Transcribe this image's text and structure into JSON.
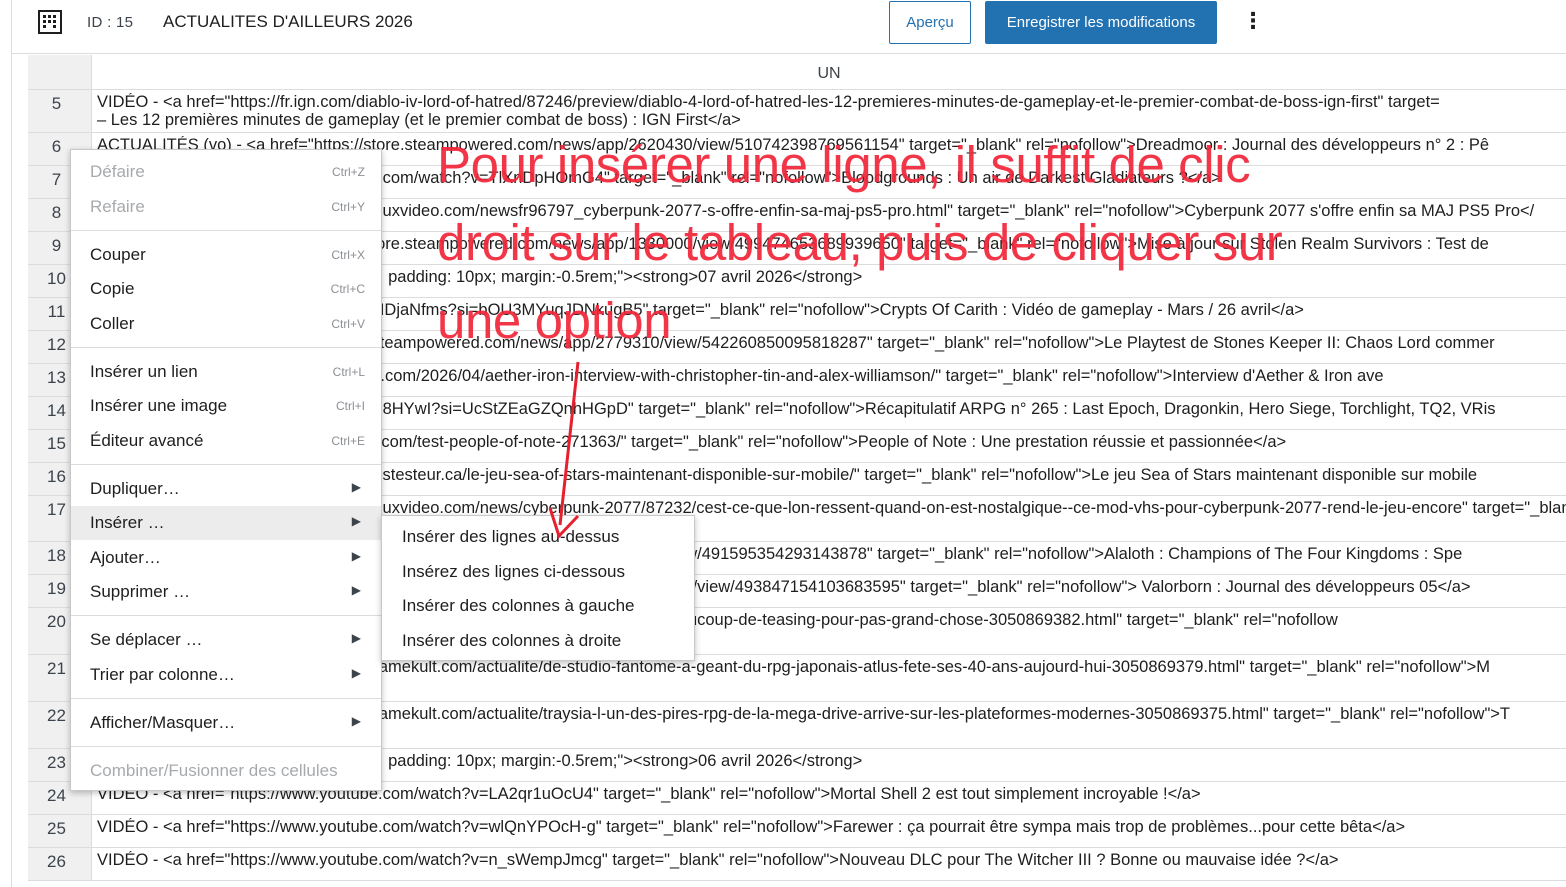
{
  "topbar": {
    "id_label": "ID : 15",
    "title": "ACTUALITES D'AILLEURS 2026",
    "preview_label": "Aperçu",
    "save_label": "Enregistrer les modifications",
    "more_glyph": "⋮"
  },
  "sheet": {
    "column_header": "UN",
    "rows": [
      {
        "num": "5",
        "line1": "VIDÉO - <a href=\"https://fr.ign.com/diablo-iv-lord-of-hatred/87246/preview/diablo-4-lord-of-hatred-les-12-premieres-minutes-de-gameplay-et-le-premier-combat-de-boss-ign-first\" target=",
        "line2": "– Les 12 premières minutes de gameplay (et le premier combat de boss) : IGN First</a>"
      },
      {
        "num": "6",
        "line1": "ACTUALITÉS (vo) - <a href=\"https://store.steampowered.com/news/app/2620430/view/510742398769561154\" target=\"_blank\" rel=\"nofollow\">Dreadmoor : Journal des développeurs n° 2 : Pê",
        "line2": ""
      },
      {
        "num": "7",
        "line1": "VIDÉO - <a href=\"https://www.youtube.com/watch?v=TlXnDpHOmG4\" target=\"_blank\" rel=\"nofollow\">Bloodgrounds : Un air de Darkest Gladiateurs ?</a>",
        "line2": ""
      },
      {
        "num": "8",
        "line1": "ACTUALITÉS - <a href=\"https://www.jeuxvideo.com/newsfr96797_cyberpunk-2077-s-offre-enfin-sa-maj-ps5-pro.html\" target=\"_blank\" rel=\"nofollow\">Cyberpunk 2077 s'offre enfin sa MAJ PS5 Pro</",
        "line2": ""
      },
      {
        "num": "9",
        "line1": "ACTUALITÉS (vo) - <a href=\"https://store.steampowered.com/news/app/1330000/view/499474653689939650\" target=\"_blank\" rel=\"nofollow\">Mise à jour sur Stolen Realm Survivors : Test de",
        "line2": ""
      },
      {
        "num": "10",
        "line1": "<p style=\"background-color: #D1E5BA; padding: 10px; margin:-0.5rem;\"><strong>07 avril 2026</strong>",
        "line2": ""
      },
      {
        "num": "11",
        "line1": "VIDÉO - <a href=\"https://youtu.be/y5XlIDjaNfms?si=bOU3MYuqJDNkugB5\" target=\"_blank\" rel=\"nofollow\">Crypts Of Carith : Vidéo de gameplay - Mars / 26 avril</a>",
        "line2": ""
      },
      {
        "num": "12",
        "line1": "ACTUALITÉS - <a href=\"https://store.steampowered.com/news/app/2779310/view/542260850095818287\" target=\"_blank\" rel=\"nofollow\">Le Playtest de Stones Keeper II: Chaos Lord commer",
        "line2": ""
      },
      {
        "num": "13",
        "line1": "INTERVIEW - <a href=\"https://rpgamer.com/2026/04/aether-iron-interview-with-christopher-tin-and-alex-williamson/\" target=\"_blank\" rel=\"nofollow\">Interview d'Aether & Iron ave",
        "line2": ""
      },
      {
        "num": "14",
        "line1": "VIDÉO - <a href=\"https://youtu.be/fevio8HYwI?si=UcStZEaGZQnhHGpD\" target=\"_blank\" rel=\"nofollow\">Récapitulatif ARPG n° 265 : Last Epoch, Dragonkin, Hero Siege, Torchlight, TQ2, VRis",
        "line2": ""
      },
      {
        "num": "15",
        "line1": "TEST - <a href=\"https://www.gamekult.com/test-people-of-note-271363/\" target=\"_blank\" rel=\"nofollow\">People of Note : Une prestation réussie et passionnée</a>",
        "line2": ""
      },
      {
        "num": "16",
        "line1": "ACTUALITÉS - <a href=\"https://www.lestesteur.ca/le-jeu-sea-of-stars-maintenant-disponible-sur-mobile/\" target=\"_blank\" rel=\"nofollow\">Le jeu Sea of Stars maintenant disponible sur mobile",
        "line2": ""
      },
      {
        "num": "17",
        "line1": "ACTUALITÉS - <a href=\"https://www.jeuxvideo.com/news/cyberpunk-2077/87232/cest-ce-que-lon-ressent-quand-on-est-nostalgique--ce-mod-vhs-pour-cyberpunk-2077-rend-le-jeu-encore\" target=\"_blank\"",
        "line2": "plus réaliste</a>"
      },
      {
        "num": "18",
        "line1": "ACTUALITÉS - <a href=\"https://store.steampowered.com/news/app/3024460/view/491595354293143878\" target=\"_blank\" rel=\"nofollow\">Alaloth : Champions of The Four Kingdoms : Spe",
        "line2": ""
      },
      {
        "num": "19",
        "line1": "ACTUALITÉS (vo) - <a href=\"https://store.steampowered.com/news/app/2156530/view/493847154103683595\" target=\"_blank\" rel=\"nofollow\"> Valorborn : Journal des développeurs 05</a>",
        "line2": ""
      },
      {
        "num": "20",
        "line1": "ACTUALITÉS - <a href=\"https://www.gamekult.com/actualite/cest-finalement-beaucoup-de-teasing-pour-pas-grand-chose-3050869382.html\" target=\"_blank\" rel=\"nofollow",
        "line2": ""
      },
      {
        "num": "21",
        "line1": "ACTUALITÉS - <a href=\"https://www.gamekult.com/actualite/de-studio-fantome-a-geant-du-rpg-japonais-atlus-fete-ses-40-ans-aujourd-hui-3050869379.html\" target=\"_blank\" rel=\"nofollow\">M",
        "line2": "d'hui</a>"
      },
      {
        "num": "22",
        "line1": "ACTUALITÉS - <a href=\"https://www.gamekult.com/actualite/traysia-l-un-des-pires-rpg-de-la-mega-drive-arrive-sur-les-plateformes-modernes-3050869375.html\" target=\"_blank\" rel=\"nofollow\">T",
        "line2": "</a>"
      },
      {
        "num": "23",
        "line1": "<p style=\"background-color: #D1E5BA; padding: 10px; margin:-0.5rem;\"><strong>06 avril 2026</strong>",
        "line2": ""
      },
      {
        "num": "24",
        "line1": "VIDÉO - <a href=\"https://www.youtube.com/watch?v=LA2qr1uOcU4\" target=\"_blank\" rel=\"nofollow\">Mortal Shell 2 est tout simplement incroyable !</a>",
        "line2": ""
      },
      {
        "num": "25",
        "line1": "VIDÉO - <a href=\"https://www.youtube.com/watch?v=wlQnYPOcH-g\" target=\"_blank\" rel=\"nofollow\">Farewer : ça pourrait être sympa mais trop de problèmes...pour cette bêta</a>",
        "line2": ""
      },
      {
        "num": "26",
        "line1": "VIDÉO - <a href=\"https://www.youtube.com/watch?v=n_sWempJmcg\" target=\"_blank\" rel=\"nofollow\">Nouveau DLC pour The Witcher III ? Bonne ou mauvaise idée ?</a>",
        "line2": ""
      }
    ]
  },
  "context_menu": {
    "items": [
      {
        "label": "Défaire",
        "shortcut": "Ctrl+Z",
        "disabled": true
      },
      {
        "label": "Refaire",
        "shortcut": "Ctrl+Y",
        "disabled": true
      },
      {
        "label": "Couper",
        "shortcut": "Ctrl+X"
      },
      {
        "label": "Copie",
        "shortcut": "Ctrl+C"
      },
      {
        "label": "Coller",
        "shortcut": "Ctrl+V"
      },
      {
        "label": "Insérer un lien",
        "shortcut": "Ctrl+L"
      },
      {
        "label": "Insérer une image",
        "shortcut": "Ctrl+I"
      },
      {
        "label": "Éditeur avancé",
        "shortcut": "Ctrl+E"
      },
      {
        "label": "Dupliquer…",
        "has_submenu": true
      },
      {
        "label": "Insérer …",
        "has_submenu": true,
        "active": true
      },
      {
        "label": "Ajouter…",
        "has_submenu": true
      },
      {
        "label": "Supprimer …",
        "has_submenu": true
      },
      {
        "label": "Se déplacer …",
        "has_submenu": true
      },
      {
        "label": "Trier par colonne…",
        "has_submenu": true
      },
      {
        "label": "Afficher/Masquer…",
        "has_submenu": true
      },
      {
        "label": "Combiner/Fusionner des cellules",
        "disabled": true
      }
    ],
    "chevron_glyph": "▶"
  },
  "submenu": {
    "items": [
      {
        "label": "Insérer des lignes au-dessus"
      },
      {
        "label": "Insérez des lignes ci-dessous"
      },
      {
        "label": "Insérer des colonnes à gauche"
      },
      {
        "label": "Insérer des colonnes à droite"
      }
    ]
  },
  "annotation": {
    "lines": [
      "Pour insérer une ligne, il suffit de clic",
      "droit sur le tableau, puis de cliquer sur",
      "une option"
    ],
    "color": "#f2273a"
  },
  "colors": {
    "accent": "#2271b1",
    "header_bg": "#f0f0f1",
    "border": "#dcdcde"
  }
}
